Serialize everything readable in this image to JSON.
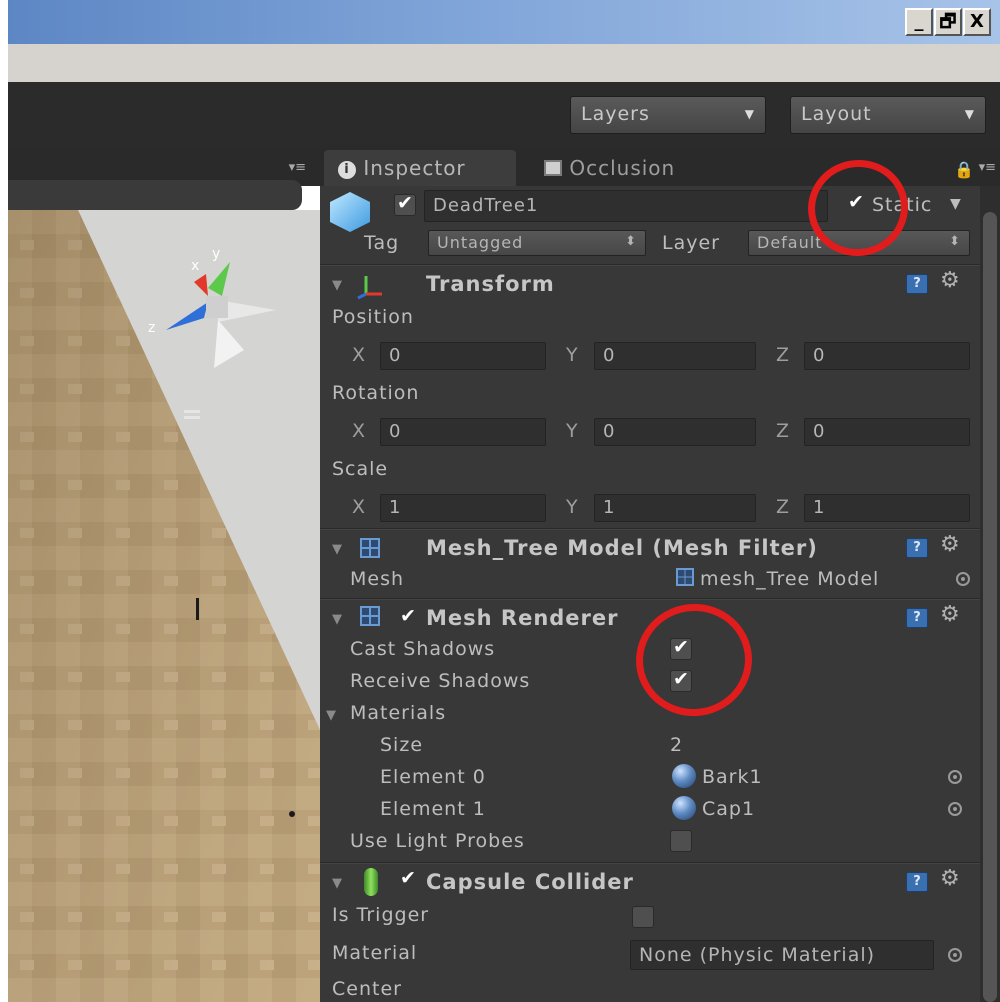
{
  "window": {
    "btn_min": "_",
    "btn_restore": "🗗",
    "btn_close": "X"
  },
  "toolbar": {
    "layers_label": "Layers",
    "layout_label": "Layout"
  },
  "tabs": {
    "inspector": "Inspector",
    "occlusion": "Occlusion"
  },
  "object": {
    "name": "DeadTree1",
    "active": true,
    "static_label": "Static",
    "static": true,
    "tag_label": "Tag",
    "tag_value": "Untagged",
    "layer_label": "Layer",
    "layer_value": "Default"
  },
  "transform": {
    "title": "Transform",
    "position_label": "Position",
    "rotation_label": "Rotation",
    "scale_label": "Scale",
    "x_label": "X",
    "y_label": "Y",
    "z_label": "Z",
    "position": {
      "x": "0",
      "y": "0",
      "z": "0"
    },
    "rotation": {
      "x": "0",
      "y": "0",
      "z": "0"
    },
    "scale": {
      "x": "1",
      "y": "1",
      "z": "1"
    }
  },
  "mesh_filter": {
    "title": "Mesh_Tree Model (Mesh Filter)",
    "mesh_label": "Mesh",
    "mesh_value": "mesh_Tree Model"
  },
  "mesh_renderer": {
    "title": "Mesh Renderer",
    "enabled": true,
    "cast_shadows_label": "Cast Shadows",
    "cast_shadows": true,
    "receive_shadows_label": "Receive Shadows",
    "receive_shadows": true,
    "materials_label": "Materials",
    "size_label": "Size",
    "size_value": "2",
    "element0_label": "Element 0",
    "element0_value": "Bark1",
    "element1_label": "Element 1",
    "element1_value": "Cap1",
    "light_probes_label": "Use Light Probes",
    "light_probes": false
  },
  "capsule_collider": {
    "title": "Capsule Collider",
    "enabled": true,
    "is_trigger_label": "Is Trigger",
    "is_trigger": false,
    "material_label": "Material",
    "material_value": "None (Physic Material)",
    "center_label": "Center"
  },
  "gizmo": {
    "x_label": "x",
    "y_label": "y",
    "z_label": "z"
  },
  "colors": {
    "annotation": "#e01c1c",
    "panel": "#383838",
    "accent": "#3a6fb0"
  }
}
